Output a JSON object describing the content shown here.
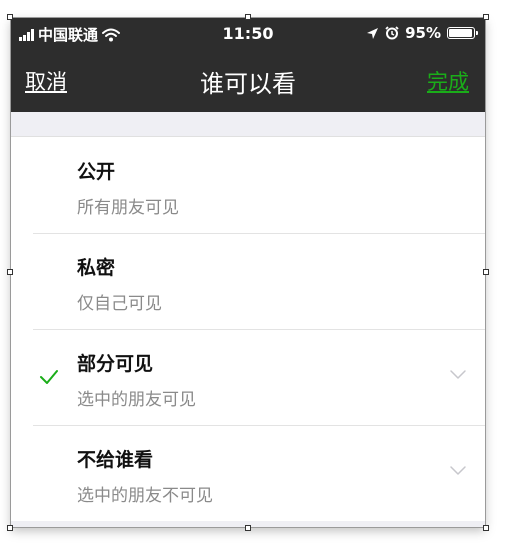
{
  "status_bar": {
    "carrier": "中国联通",
    "time": "11:50",
    "battery_text": "95%",
    "battery_level": 0.95
  },
  "nav": {
    "cancel_label": "取消",
    "title": "谁可以看",
    "done_label": "完成",
    "done_color": "#1aad19"
  },
  "options": [
    {
      "title": "公开",
      "subtitle": "所有朋友可见",
      "selected": false,
      "expandable": false
    },
    {
      "title": "私密",
      "subtitle": "仅自己可见",
      "selected": false,
      "expandable": false
    },
    {
      "title": "部分可见",
      "subtitle": "选中的朋友可见",
      "selected": true,
      "expandable": true
    },
    {
      "title": "不给谁看",
      "subtitle": "选中的朋友不可见",
      "selected": false,
      "expandable": true
    }
  ],
  "icons": {
    "check": "check-icon",
    "chevron": "chevron-down-icon",
    "signal": "signal-icon",
    "wifi": "wifi-icon",
    "location": "location-arrow-icon",
    "alarm": "alarm-icon",
    "battery": "battery-icon"
  },
  "colors": {
    "accent": "#1aad19",
    "nav_background": "#2d2d2d",
    "page_background": "#efeff4"
  }
}
